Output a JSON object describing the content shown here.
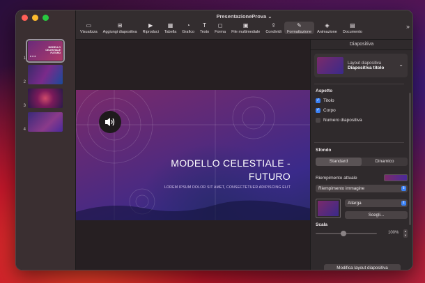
{
  "window": {
    "title": "PresentazioneProva"
  },
  "navigator": {
    "slides": [
      {
        "num": "1",
        "thumb_text": "MODELLO CELESTIALE FUTURO",
        "selected": true
      },
      {
        "num": "2",
        "selected": false
      },
      {
        "num": "3",
        "selected": false
      },
      {
        "num": "4",
        "selected": false
      }
    ]
  },
  "toolbar": {
    "items": [
      {
        "label": "Visualizza",
        "icon": "sidebar-icon"
      },
      {
        "label": "Aggiungi diapositiva",
        "icon": "add-slide-icon"
      },
      {
        "label": "Riproduci",
        "icon": "play-icon"
      },
      {
        "label": "Tabella",
        "icon": "table-icon"
      },
      {
        "label": "Grafico",
        "icon": "chart-icon"
      },
      {
        "label": "Testo",
        "icon": "text-icon"
      },
      {
        "label": "Forma",
        "icon": "shape-icon"
      },
      {
        "label": "File multimediale",
        "icon": "media-icon"
      },
      {
        "label": "Condividi",
        "icon": "share-icon"
      },
      {
        "label": "Formattazione",
        "icon": "brush-icon"
      },
      {
        "label": "Animazione",
        "icon": "animation-icon"
      },
      {
        "label": "Documento",
        "icon": "document-icon"
      }
    ]
  },
  "slide": {
    "title": "MODELLO CELESTIALE - FUTURO",
    "subtitle": "LOREM IPSUM DOLOR SIT AMET, CONSECTETUER ADIPISCING ELIT"
  },
  "inspector": {
    "tab": "Diapositiva",
    "layout_label": "Layout diapositiva",
    "layout_value": "Diapositiva titolo",
    "appearance_title": "Aspetto",
    "checkboxes": [
      {
        "label": "Titolo",
        "checked": true
      },
      {
        "label": "Corpo",
        "checked": true
      },
      {
        "label": "Numero diapositiva",
        "checked": false
      }
    ],
    "background_title": "Sfondo",
    "bg_standard": "Standard",
    "bg_dynamic": "Dinamico",
    "current_fill": "Riempimento attuale",
    "fill_type": "Riempimento immagine",
    "scale_mode": "Allarga",
    "choose": "Scegli...",
    "scale_label": "Scala",
    "scale_value": "100%",
    "edit_layout": "Modifica layout diapositiva"
  }
}
